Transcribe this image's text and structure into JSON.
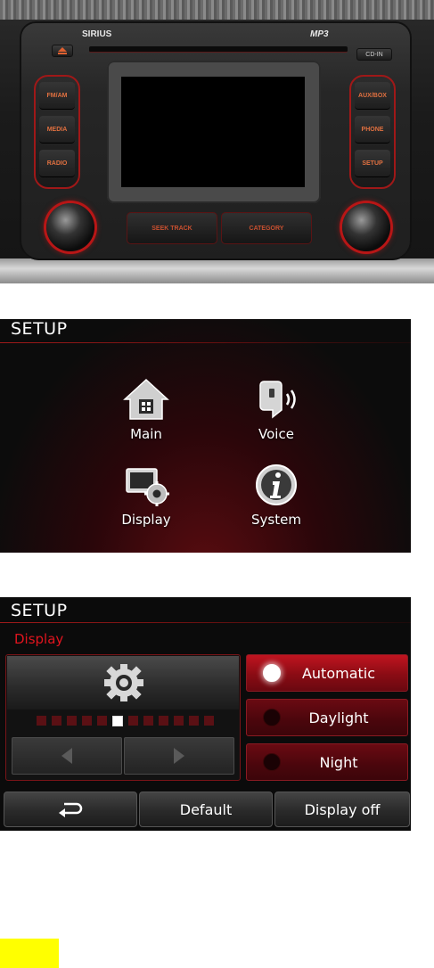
{
  "head_unit": {
    "brand_left": "SIRIUS",
    "brand_right": "MP3",
    "cd_in_label": "CD-IN",
    "left_keys": [
      "FM/AM",
      "MEDIA",
      "RADIO"
    ],
    "right_keys": [
      "AUX/BOX",
      "PHONE",
      "SETUP"
    ],
    "seek_track_label": "SEEK TRACK",
    "category_label": "CATEGORY"
  },
  "setup_screen": {
    "title": "SETUP",
    "items": [
      {
        "label": "Main",
        "icon": "home-icon"
      },
      {
        "label": "Voice",
        "icon": "voice-icon"
      },
      {
        "label": "Display",
        "icon": "display-settings-icon"
      },
      {
        "label": "System",
        "icon": "info-icon"
      }
    ]
  },
  "display_screen": {
    "title": "SETUP",
    "section": "Display",
    "brightness": {
      "level": 6,
      "total": 12
    },
    "modes": [
      {
        "label": "Automatic",
        "selected": true
      },
      {
        "label": "Daylight",
        "selected": false
      },
      {
        "label": "Night",
        "selected": false
      }
    ],
    "bottom": {
      "back_icon": "back-arrow-icon",
      "default_label": "Default",
      "display_off_label": "Display off"
    },
    "colors": {
      "accent": "#e0141e",
      "selected_mode": "#c01420"
    }
  }
}
